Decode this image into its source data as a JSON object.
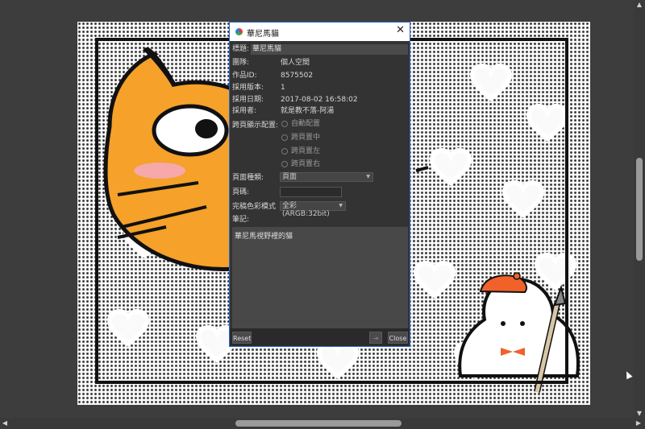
{
  "dialog": {
    "window_title": "華尼馬貓",
    "close_glyph": "✕",
    "title_label": "標題:",
    "title_value": "華尼馬貓",
    "fields": [
      {
        "label": "團隊:",
        "value": "個人空間"
      },
      {
        "label": "作品ID:",
        "value": "8575502"
      },
      {
        "label": "採用版本:",
        "value": "1"
      },
      {
        "label": "採用日期:",
        "value": "2017-08-02 16:58:02"
      },
      {
        "label": "採用者:",
        "value": "就是教不落-阿湯"
      }
    ],
    "spread_label": "跨頁顯示配置:",
    "spread_options": [
      "自動配置",
      "跨頁置中",
      "跨頁置左",
      "跨頁置右"
    ],
    "page_type_label": "頁面種類:",
    "page_type_value": "頁面",
    "page_number_label": "頁碼:",
    "color_mode_label": "完稿色彩模式",
    "color_mode_value": "全彩 (ARGB:32bit)",
    "notes_label": "筆記:",
    "notes_text": "華尼馬視野裡的貓",
    "reset_button": "Reset",
    "next_glyph": "⇥",
    "close_button": "Close"
  },
  "colors": {
    "dialog_bg": "#333333",
    "accent_border": "#2a6ad0",
    "cat_orange": "#f5a12a",
    "beret_orange": "#f0622a"
  }
}
